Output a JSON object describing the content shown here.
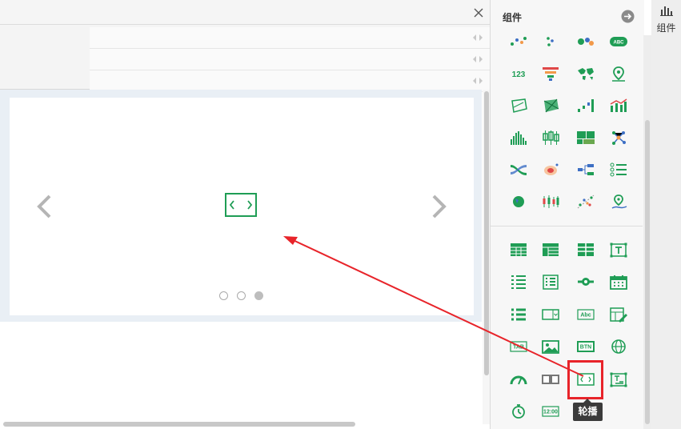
{
  "panel": {
    "title": "组件",
    "toggle_icon": "arrow-right-circle-icon",
    "chart_icons": [
      "scatter-icon",
      "dot-plot-icon",
      "bubble-icon",
      "word-cloud-icon",
      "number-icon",
      "funnel-icon",
      "world-map-icon",
      "map-pin-icon",
      "radar-icon",
      "radar-filled-icon",
      "step-bar-icon",
      "combo-chart-icon",
      "histogram-icon",
      "boxplot-icon",
      "treemap-icon",
      "network-icon",
      "sankey-icon",
      "heat-icon",
      "tree-icon",
      "list-tree-icon",
      "globe-chart-icon",
      "candlestick-icon",
      "scatter-trend-icon",
      "route-map-icon"
    ],
    "widget_icons": [
      "table-icon",
      "crosstab-icon",
      "grouped-table-icon",
      "text-box-icon",
      "list-report-icon",
      "detail-list-icon",
      "slider-icon",
      "calendar-icon",
      "list-icon",
      "dropdown-icon",
      "text-input-icon",
      "edit-form-icon",
      "tab-icon",
      "image-icon",
      "button-icon",
      "web-icon",
      "gauge-icon",
      "split-icon",
      "carousel-icon",
      "text-frame-icon",
      "timer-icon",
      "clock-icon"
    ],
    "carousel_tooltip": "轮播",
    "button_text": "BTN",
    "tab_text": "TAB",
    "number_text": "123",
    "abc_text": "Abc",
    "clock_text": "12:00",
    "wordcloud_text": "ABC"
  },
  "sidebar": {
    "label": "组件",
    "icon": "bar-chart-icon"
  },
  "editor": {
    "close_icon": "close-icon",
    "carousel_dots": [
      false,
      false,
      true
    ]
  },
  "colors": {
    "accent": "#1f9d55",
    "highlight": "#e8242a",
    "tooltip_bg": "#3b3b3b"
  }
}
